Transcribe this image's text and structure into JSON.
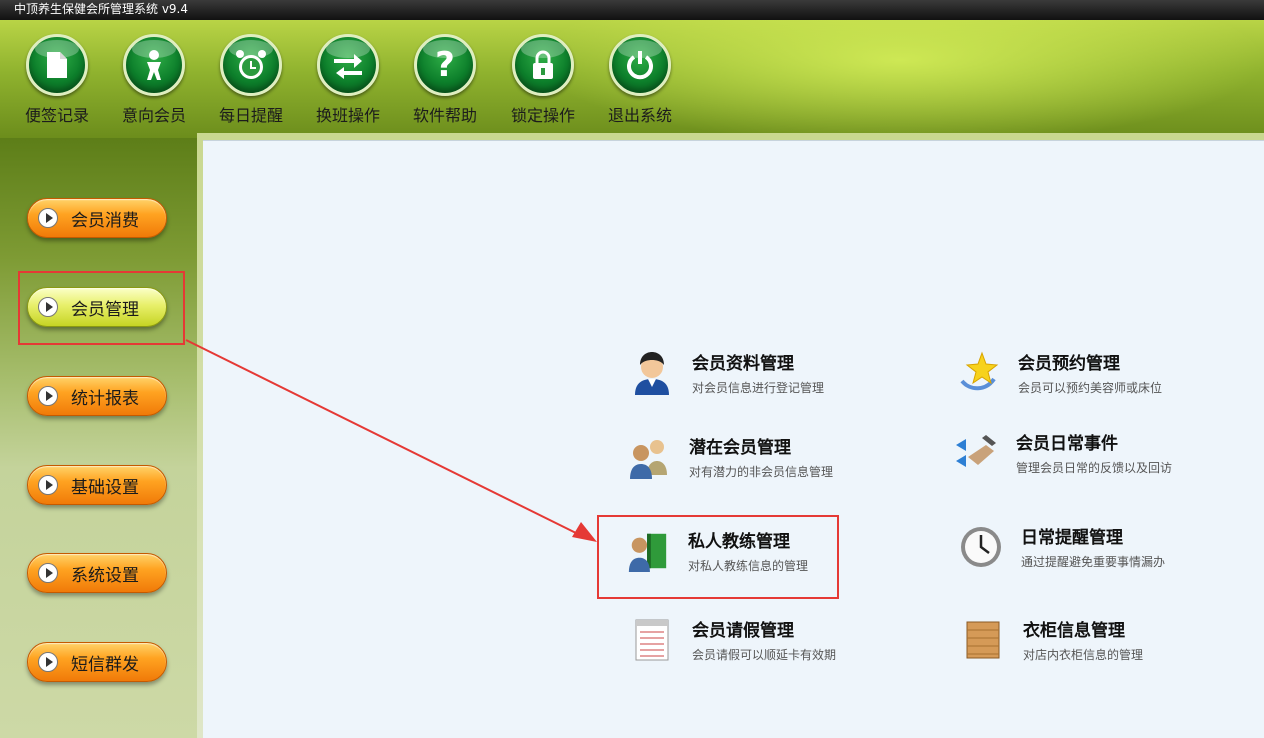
{
  "window": {
    "title": "中顶养生保健会所管理系统 v9.4"
  },
  "toolbar": {
    "items": [
      {
        "label": "便签记录",
        "icon": "notepad-icon"
      },
      {
        "label": "意向会员",
        "icon": "person-icon"
      },
      {
        "label": "每日提醒",
        "icon": "alarm-clock-icon"
      },
      {
        "label": "换班操作",
        "icon": "swap-arrows-icon"
      },
      {
        "label": "软件帮助",
        "icon": "question-icon"
      },
      {
        "label": "锁定操作",
        "icon": "lock-icon"
      },
      {
        "label": "退出系统",
        "icon": "power-icon"
      }
    ]
  },
  "sidebar": {
    "items": [
      {
        "label": "会员消费"
      },
      {
        "label": "会员管理",
        "active": true
      },
      {
        "label": "统计报表"
      },
      {
        "label": "基础设置"
      },
      {
        "label": "系统设置"
      },
      {
        "label": "短信群发"
      }
    ]
  },
  "main": {
    "items": [
      {
        "title": "会员资料管理",
        "desc": "对会员信息进行登记管理",
        "icon": "member-avatar-icon"
      },
      {
        "title": "会员预约管理",
        "desc": "会员可以预约美容师或床位",
        "icon": "star-icon"
      },
      {
        "title": "潜在会员管理",
        "desc": "对有潜力的非会员信息管理",
        "icon": "people-icon"
      },
      {
        "title": "会员日常事件",
        "desc": "管理会员日常的反馈以及回访",
        "icon": "writing-hand-icon"
      },
      {
        "title": "私人教练管理",
        "desc": "对私人教练信息的管理",
        "icon": "coach-book-icon"
      },
      {
        "title": "日常提醒管理",
        "desc": "通过提醒避免重要事情漏办",
        "icon": "clock-icon"
      },
      {
        "title": "会员请假管理",
        "desc": "会员请假可以顺延卡有效期",
        "icon": "notepad-lines-icon"
      },
      {
        "title": "衣柜信息管理",
        "desc": "对店内衣柜信息的管理",
        "icon": "wooden-cabinet-icon"
      }
    ]
  },
  "colors": {
    "highlight": "#e53935",
    "nav_orange": "#ffa321",
    "nav_active": "#e8f06b",
    "panel_bg": "#eef5fb"
  }
}
